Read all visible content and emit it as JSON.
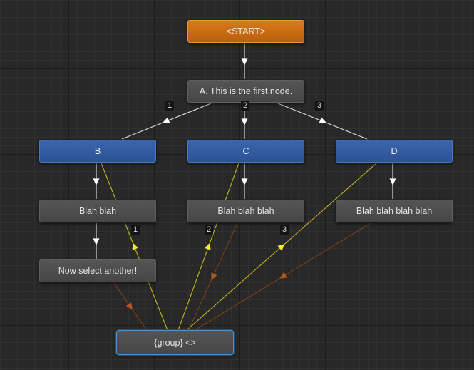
{
  "colors": {
    "start": "#c8691a",
    "gray_node": "#4d4d4d",
    "blue_node": "#3360a6",
    "group_border": "#4a8fd0",
    "edge_white": "#d8d8d8",
    "edge_yellow": "#c4b51f",
    "edge_brown": "#7a3e1c",
    "arrow_white": "#ffffff",
    "arrow_yellow": "#f2ea2a",
    "arrow_brown": "#b8561c"
  },
  "nodes": {
    "start": "<START>",
    "a": "A. This is the first node.",
    "b": "B",
    "c": "C",
    "d": "D",
    "blah1": "Blah blah",
    "blah2": "Blah blah blah",
    "blah3": "Blah blah blah blah",
    "select": "Now select another!",
    "group": "{group} <>"
  },
  "edge_labels": {
    "a_b": "1",
    "a_c": "2",
    "a_d": "3",
    "group_b": "1",
    "group_c": "2",
    "group_d": "3"
  }
}
